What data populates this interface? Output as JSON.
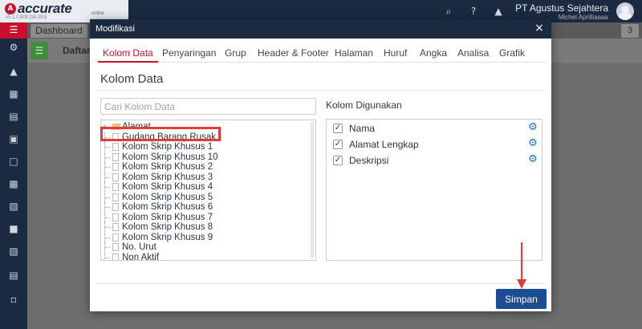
{
  "app": {
    "logo_text": "accurate",
    "logo_sub": "online",
    "version": "v5.1.0.809 [38.253]",
    "company_name": "PT Agustus Sejahtera",
    "user_name": "Michel Aprilliaaaa"
  },
  "topbar_icons": [
    "search-icon",
    "help-icon",
    "bell-icon"
  ],
  "background": {
    "tab_dashboard": "Dashboard",
    "tab_count": "3",
    "page_label": "Daftar"
  },
  "modal": {
    "title": "Modifikasi",
    "close_symbol": "×",
    "tabs": [
      "Kolom Data",
      "Penyaringan",
      "Grup",
      "Header & Footer",
      "Halaman",
      "Huruf",
      "Angka",
      "Analisa",
      "Grafik"
    ],
    "active_tab": "Kolom Data",
    "section_title": "Kolom Data",
    "search": {
      "placeholder": "Cari Kolom Data",
      "value": ""
    },
    "tree_items": [
      "Alamat",
      "Gudang Barang Rusak",
      "Kolom Skrip Khusus 1",
      "Kolom Skrip Khusus 10",
      "Kolom Skrip Khusus 2",
      "Kolom Skrip Khusus 3",
      "Kolom Skrip Khusus 4",
      "Kolom Skrip Khusus 5",
      "Kolom Skrip Khusus 6",
      "Kolom Skrip Khusus 7",
      "Kolom Skrip Khusus 8",
      "Kolom Skrip Khusus 9",
      "No. Urut",
      "Non Aktif"
    ],
    "highlighted_item": "Gudang Barang Rusak",
    "used_title": "Kolom Digunakan",
    "used_columns": [
      {
        "label": "Nama",
        "checked": true
      },
      {
        "label": "Alamat Lengkap",
        "checked": true
      },
      {
        "label": "Deskripsi",
        "checked": true
      }
    ],
    "save_label": "Simpan"
  },
  "colors": {
    "accent_red": "#c8102e",
    "nav_dark": "#1b2a41",
    "primary_button": "#1c4d92",
    "gear_blue": "#1e6fd0",
    "annotation_red": "#e23b3b"
  }
}
